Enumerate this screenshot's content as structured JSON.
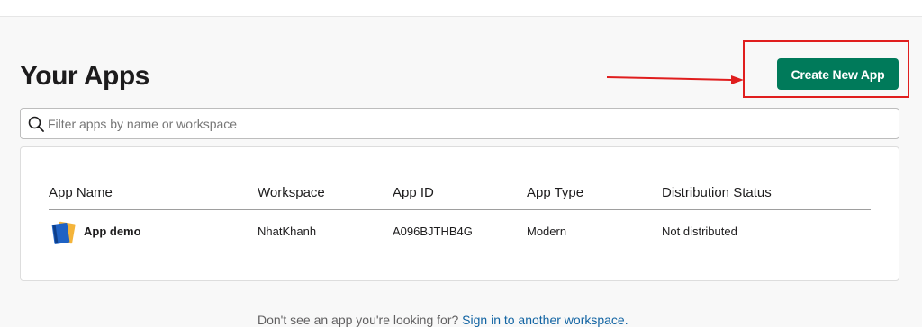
{
  "page": {
    "title": "Your Apps",
    "create_button_label": "Create New App"
  },
  "annotation": {
    "color": "#e01e1e"
  },
  "search": {
    "placeholder": "Filter apps by name or workspace",
    "value": "",
    "icon": "search-icon"
  },
  "table": {
    "columns": [
      "App Name",
      "Workspace",
      "App ID",
      "App Type",
      "Distribution Status"
    ],
    "rows": [
      {
        "icon": "notebook-icon",
        "name": "App demo",
        "workspace": "NhatKhanh",
        "app_id": "A096BJTHB4G",
        "app_type": "Modern",
        "distribution_status": "Not distributed"
      }
    ]
  },
  "footer": {
    "text": "Don't see an app you're looking for?",
    "link_text": "Sign in to another workspace."
  },
  "colors": {
    "accent": "#007a5a",
    "link": "#1264a3"
  }
}
